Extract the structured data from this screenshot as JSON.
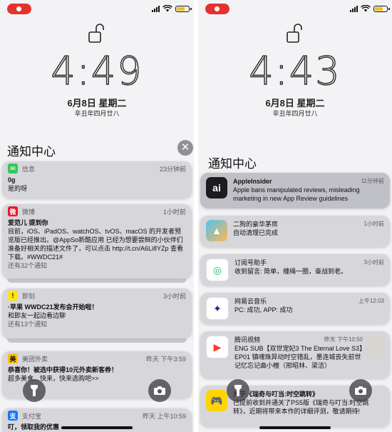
{
  "left": {
    "time": "4:49",
    "date": "6月8日 星期二",
    "lunar": "辛丑年四月廿八",
    "nc_title": "通知中心",
    "clear": "✕",
    "notifications": [
      {
        "app": "信息",
        "time": "23分钟前",
        "title": "0g",
        "body": "是的呀",
        "more": ""
      },
      {
        "app": "微博",
        "time": "1小时前",
        "title": "爱范儿 提到你",
        "body": "目前，iOS、iPadOS、watchOS、tvOS、macOS 的开发者预览版已经推出。@AppSo新酷应用 已经为想要尝鲜的小伙伴们准备好相关的描述文件了，可以点击 http://t.cn/A6Li8YZp 查看下载。#WWDC21#",
        "more": "还有32个通知"
      },
      {
        "app": "即刻",
        "time": "3小时前",
        "title": "·苹果 WWDC21发布会开始啦！",
        "body": "和即友一起边看边聊",
        "more": "还有13个通知"
      },
      {
        "app": "美团外卖",
        "time": "昨天 下午3:59",
        "title": "恭喜你！被选中获得10元外卖新客券！",
        "body": "超多美食…快来，快来选购吧>>",
        "more": ""
      },
      {
        "app": "支付宝",
        "time": "昨天 上午10:59",
        "title": "叮，领取我的优惠",
        "body": "",
        "more": ""
      }
    ]
  },
  "right": {
    "time": "4:43",
    "date": "6月8日 星期二",
    "lunar": "辛丑年四月廿八",
    "nc_title": "通知中心",
    "clear": "✕",
    "notifications": [
      {
        "app": "AppleInsider",
        "time": "11分钟前",
        "body": "Apple bans manipulated reviews, misleading marketing in new App Review guidelines"
      },
      {
        "app": "二狗的豪华茅房",
        "time": "1小时前",
        "body": "自动清理已完成"
      },
      {
        "app": "订阅号助手",
        "time": "3小时前",
        "body": "收到留言: 简单，缠绳一圈，奋战到老。"
      },
      {
        "app": "网易云音乐",
        "time": "上午12:03",
        "body": "PC: 成功, APP: 成功"
      },
      {
        "app": "腾讯视频",
        "time": "昨天 下午10:50",
        "body": "ENG SUB【双世宠妃3 The Eternal Love S3】EP01 镇魂珠异动时空错乱，墨连城丧失前世记忆忘记曲小檀（邢昭林、梁洁）"
      },
      {
        "app": "关于《瑞奇与叮当:时空跳转》",
        "time": "",
        "body": "已提前收到并通关了PS5版《瑞奇与叮当:时空跳转》，近期将带来本作的详细评测，敬请期待!"
      }
    ]
  },
  "colors": {
    "record": "#e5322f",
    "battery": "#f2c012"
  },
  "icons": [
    "record-icon",
    "signal-icon",
    "wifi-icon",
    "battery-icon",
    "unlock-icon",
    "flashlight-icon",
    "camera-icon"
  ]
}
